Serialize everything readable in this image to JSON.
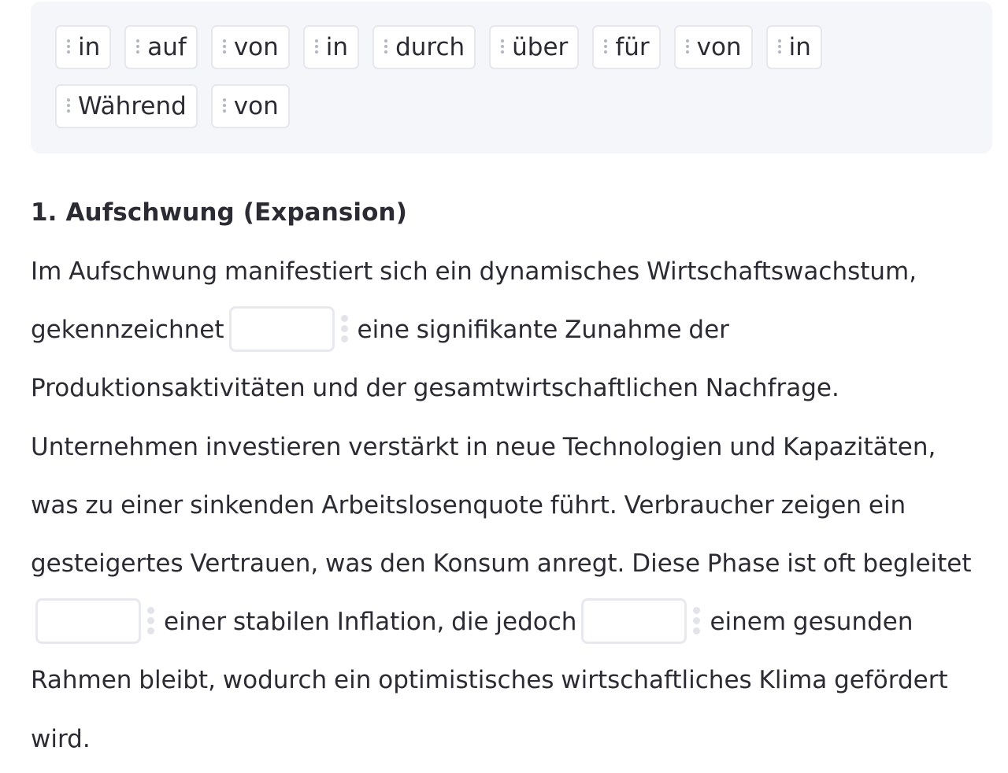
{
  "word_bank": {
    "rows": [
      [
        "in",
        "auf",
        "von",
        "in",
        "durch",
        "über",
        "für",
        "von",
        "in"
      ],
      [
        "Während",
        "von"
      ]
    ]
  },
  "section": {
    "title": "1. Aufschwung (Expansion)",
    "segments": [
      "Im Aufschwung manifestiert sich ein dynamisches Wirtschaftswachstum, gekennzeichnet",
      "eine signifikante Zunahme der Produktionsaktivitäten und der gesamtwirtschaftlichen Nachfrage. Unternehmen investieren verstärkt in neue Technologien und Kapazitäten, was zu einer sinkenden Arbeitslosenquote führt. Verbraucher zeigen ein gesteigertes Vertrauen, was den Konsum anregt. Diese Phase ist oft begleitet",
      "einer stabilen Inflation, die jedoch",
      "einem gesunden Rahmen bleibt, wodurch ein optimistisches wirtschaftliches Klima gefördert wird."
    ],
    "blanks": [
      {
        "value": ""
      },
      {
        "value": ""
      },
      {
        "value": ""
      }
    ]
  }
}
